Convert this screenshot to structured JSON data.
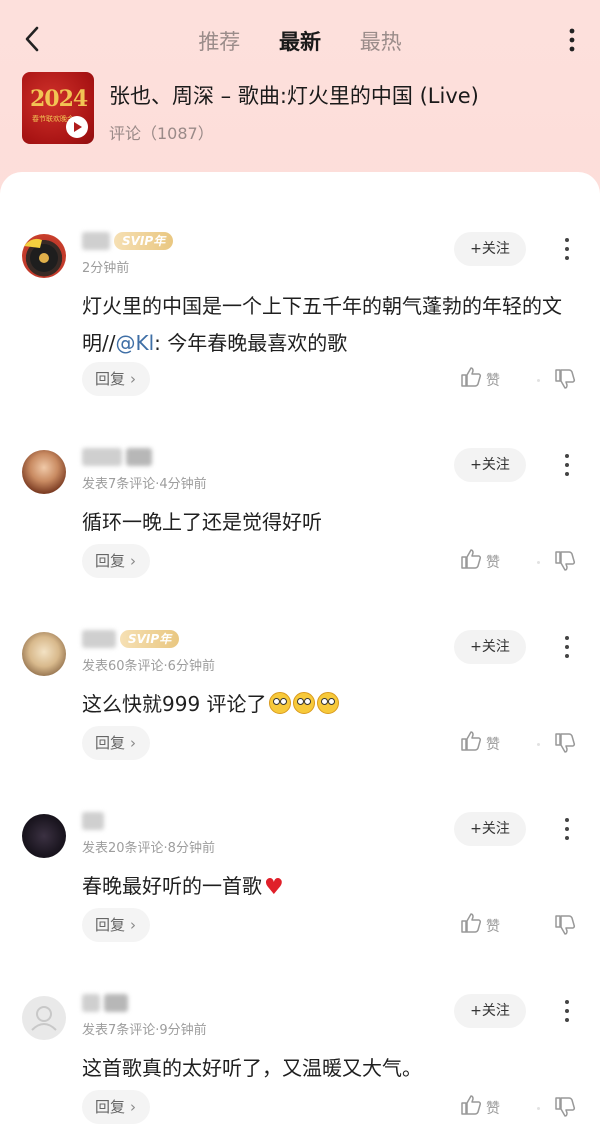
{
  "header": {
    "tabs": [
      {
        "label": "推荐",
        "active": false
      },
      {
        "label": "最新",
        "active": true
      },
      {
        "label": "最热",
        "active": false
      }
    ]
  },
  "song": {
    "title": "张也、周深 – 歌曲:灯火里的中国 (Live)",
    "comment_count_label": "评论（1087）",
    "cover_logo_text": "2024",
    "cover_sub_text": "春节联欢晚会"
  },
  "common": {
    "follow_label": "+关注",
    "reply_label": "回复",
    "like_label": "赞"
  },
  "comments": [
    {
      "vip_badge": "SVIP年",
      "meta": "2分钟前",
      "text_before": "灯火里的中国是一个上下五千年的朝气蓬勃的年轻的文明//",
      "mention": "@Kl",
      "text_after": ": 今年春晚最喜欢的歌"
    },
    {
      "vip_badge": "",
      "meta": "发表7条评论·4分钟前",
      "text": "循环一晚上了还是觉得好听"
    },
    {
      "vip_badge": "SVIP年",
      "meta": "发表60条评论·6分钟前",
      "text": "这么快就999 评论了"
    },
    {
      "vip_badge": "",
      "meta": "发表20条评论·8分钟前",
      "text": "春晚最好听的一首歌"
    },
    {
      "vip_badge": "",
      "meta": "发表7条评论·9分钟前",
      "text": "这首歌真的太好听了，又温暖又大气。"
    }
  ],
  "colors": {
    "header_bg": "#fde0dc",
    "accent_mention": "#3f6fa6",
    "svip_gold": "#e9c781"
  }
}
